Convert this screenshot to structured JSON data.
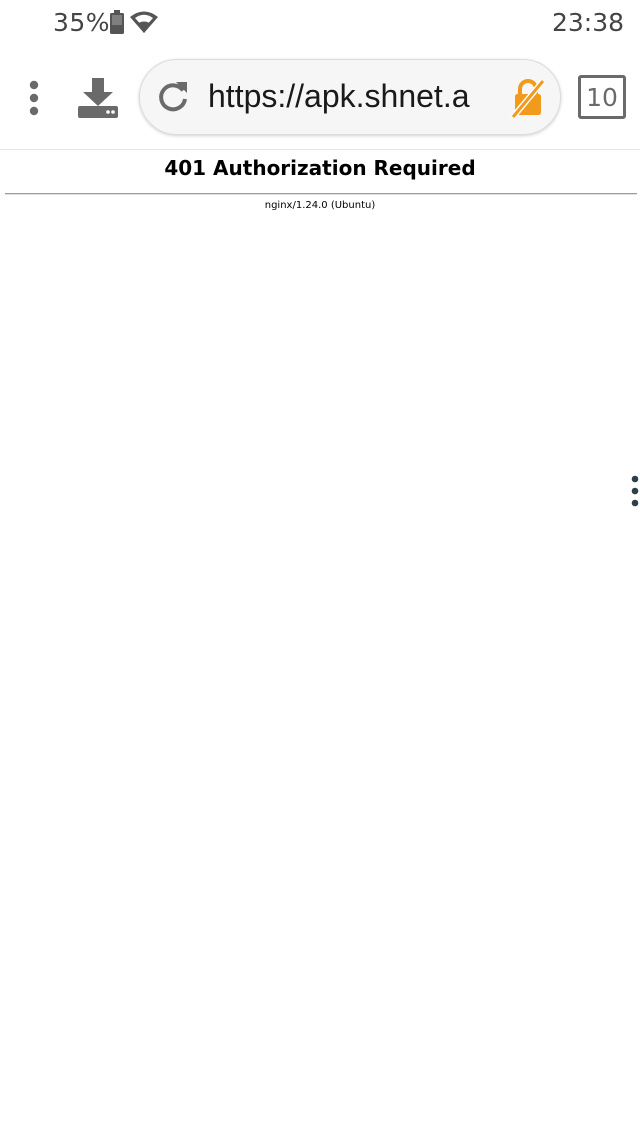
{
  "status_bar": {
    "battery_percent": "35%",
    "time": "23:38",
    "icons": [
      "battery-icon",
      "wifi-icon"
    ]
  },
  "toolbar": {
    "icons": [
      "more-vert-icon",
      "download-icon",
      "reload-icon",
      "lock-off-icon"
    ],
    "url": "https://apk.shnet.a",
    "tab_count": "10",
    "colors": {
      "lock_accent": "#f29a1c",
      "icon_gray": "#6a6a6a"
    }
  },
  "page": {
    "title": "401 Authorization Required",
    "server_info": "nginx/1.24.0 (Ubuntu)"
  },
  "side_menu": {
    "icon": "more-vert-icon",
    "color": "#2f3f4a"
  }
}
